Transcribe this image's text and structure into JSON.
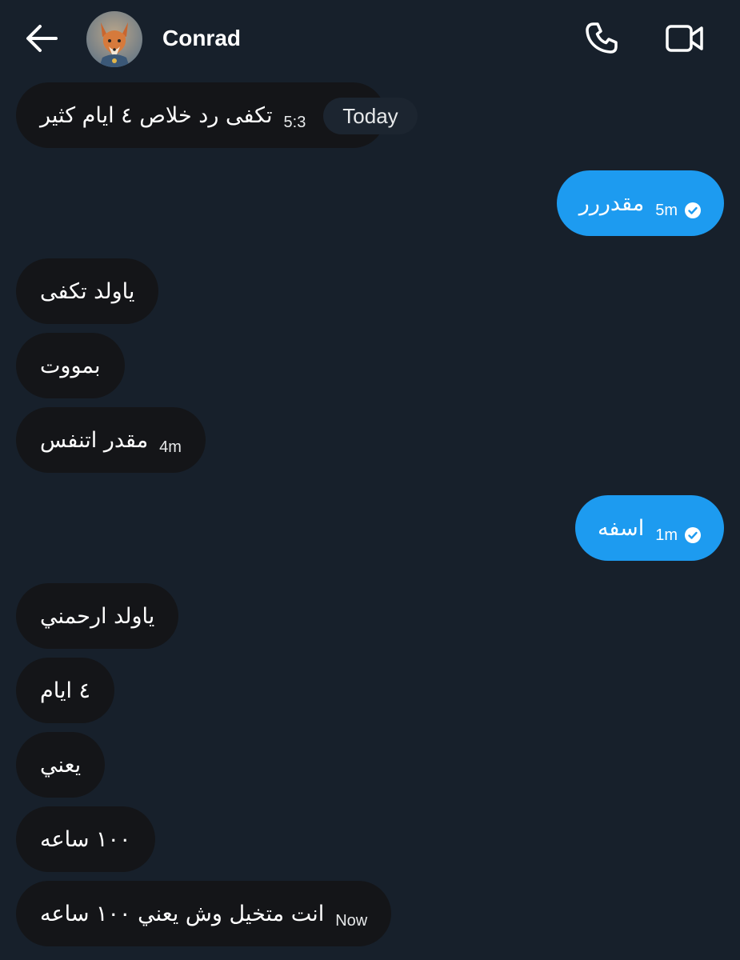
{
  "header": {
    "contact_name": "Conrad",
    "back_icon": "back-arrow-icon",
    "call_icon": "phone-icon",
    "video_icon": "video-camera-icon"
  },
  "date_divider": "Today",
  "messages": [
    {
      "direction": "incoming",
      "text": "تكفى رد خلاص ٤ ايام كثير",
      "time": "5:3"
    },
    {
      "direction": "outgoing",
      "text": "مقدررر",
      "time": "5m",
      "status": "read"
    },
    {
      "direction": "incoming",
      "text": "ياولد تكفى",
      "time": ""
    },
    {
      "direction": "incoming",
      "text": "بمووت",
      "time": ""
    },
    {
      "direction": "incoming",
      "text": "مقدر اتنفس",
      "time": "4m"
    },
    {
      "direction": "outgoing",
      "text": "اسفه",
      "time": "1m",
      "status": "read"
    },
    {
      "direction": "incoming",
      "text": "ياولد ارحمني",
      "time": ""
    },
    {
      "direction": "incoming",
      "text": "٤ ايام",
      "time": ""
    },
    {
      "direction": "incoming",
      "text": "يعني",
      "time": ""
    },
    {
      "direction": "incoming",
      "text": "١٠٠ ساعه",
      "time": ""
    },
    {
      "direction": "incoming",
      "text": "انت متخيل وش يعني ١٠٠ ساعه",
      "time": "Now"
    }
  ],
  "colors": {
    "background": "#17202b",
    "incoming_bubble": "#141518",
    "outgoing_bubble": "#1d9bf0"
  }
}
